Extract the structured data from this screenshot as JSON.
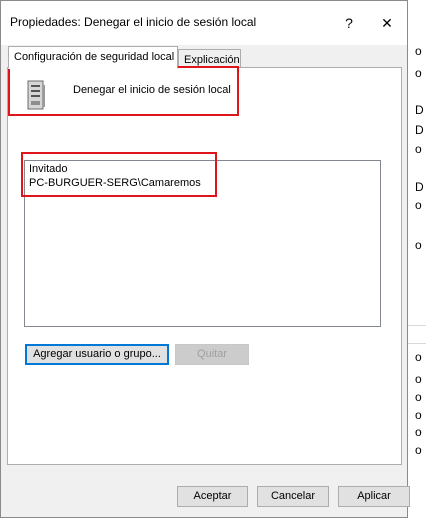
{
  "dialog": {
    "title": "Propiedades: Denegar el inicio de sesión local",
    "help_glyph": "?",
    "close_glyph": "✕"
  },
  "tabs": [
    {
      "label": "Configuración de seguridad local",
      "active": true
    },
    {
      "label": "Explicación",
      "active": false
    }
  ],
  "policy": {
    "name": "Denegar el inicio de sesión local",
    "icon": "server-policy-icon"
  },
  "members": [
    "Invitado",
    "PC-BURGUER-SERG\\Camaremos"
  ],
  "buttons": {
    "add": "Agregar usuario o grupo...",
    "remove": "Quitar",
    "ok": "Aceptar",
    "cancel": "Cancelar",
    "apply": "Aplicar"
  },
  "background_fragments": [
    "o",
    "o",
    "D",
    "D",
    "o",
    "D",
    "o",
    "o",
    "o",
    "o",
    "o",
    "o",
    "o",
    "o"
  ],
  "colors": {
    "annotation_red": "#e0141b",
    "focus_blue": "#0078d7"
  }
}
